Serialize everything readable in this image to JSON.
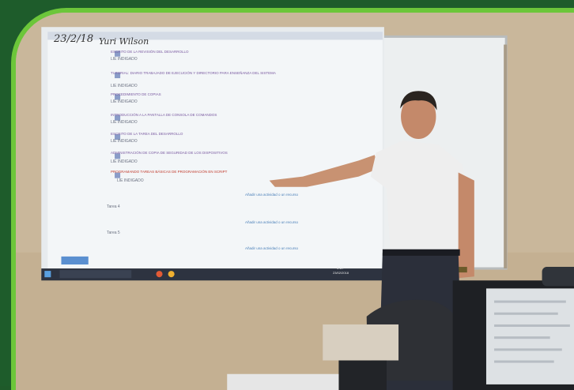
{
  "handwriting": {
    "date": "23/2/18",
    "signature": "Yuri Wilson"
  },
  "screen": {
    "list_items": [
      {
        "text": "ESCRITO DE LA REVISIÓN DEL DESARROLLO",
        "sub": "LIE INDIGADO"
      },
      {
        "text": "TUTORIAL: DIARIO TRABAJADO DE EJECUCIÓN Y DIRECTORIO PARA ENSEÑANZA DEL SISTEMA",
        "sub": "LIE INDIGADO"
      },
      {
        "text": "PROCEDIMIENTO DE COPIAS",
        "sub": "LIE INDIGADO"
      },
      {
        "text": "INTRODUCCIÓN A LA PANTALLA DE CONSOLA DE COMANDOS",
        "sub": "LIE INDIGADO"
      },
      {
        "text": "ESCRITO DE LA TAREA DEL DESARROLLO",
        "sub": "LIE INDIGADO"
      },
      {
        "text": "ADMINISTRACIÓN DE COPIA DE SEGURIDAD DE LOS DISPOSITIVOS",
        "sub": "LIE INDIGADO"
      },
      {
        "text": "PROGRAMANDO TAREAS BÁSICAS DE PROGRAMACIÓN EN SCRIPT",
        "sub": "LIE INDIGADO"
      }
    ],
    "sections": [
      "Tarea 4",
      "Tarea 5"
    ],
    "add_activity": "Añadir una actividad o un recurso",
    "taskbar_time": "9:17",
    "taskbar_date": "23/02/2018"
  },
  "colors": {
    "frame_dark": "#1e5c2b",
    "frame_light": "#6cc63a",
    "wall": "#c9b79b",
    "whiteboard": "#eef1f3",
    "projection": "#f2f6f8",
    "shirt": "#eeeeee",
    "pants": "#2b2f3a"
  }
}
